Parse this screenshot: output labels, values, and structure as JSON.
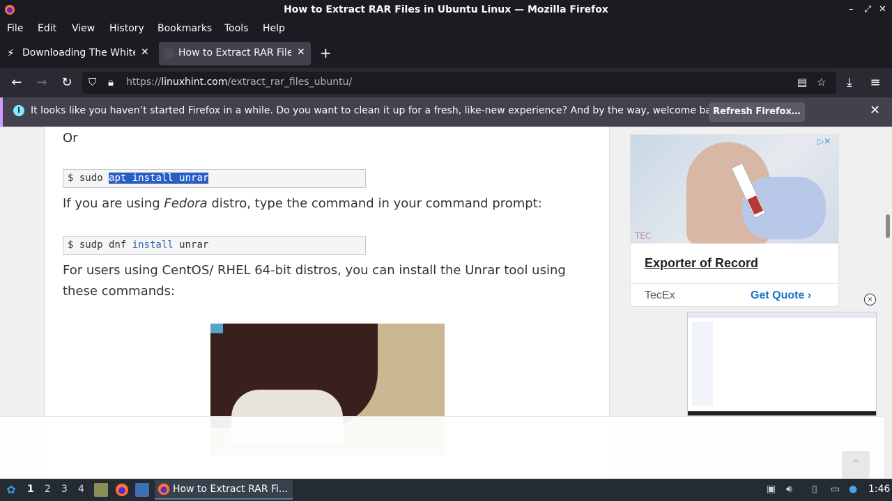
{
  "window": {
    "title": "How to Extract RAR Files in Ubuntu Linux — Mozilla Firefox",
    "controls": [
      "minimize",
      "maximize",
      "close"
    ]
  },
  "menu": {
    "items": [
      "File",
      "Edit",
      "View",
      "History",
      "Bookmarks",
      "Tools",
      "Help"
    ]
  },
  "tabs": [
    {
      "label": "Downloading The White House",
      "active": false,
      "icon": "lightning-icon"
    },
    {
      "label": "How to Extract RAR Files",
      "active": true,
      "icon": "linuxhint-favicon-icon"
    }
  ],
  "navbar": {
    "url_prefix": "https://",
    "url_domain": "linuxhint.com",
    "url_path": "/extract_rar_files_ubuntu/"
  },
  "notification": {
    "message": "It looks like you haven’t started Firefox in a while. Do you want to clean it up for a fresh, like-new experience? And by the way, welcome back!",
    "button_label": "Refresh Firefox…"
  },
  "article": {
    "or_text": "Or",
    "cmd1_prompt": "$ sudo ",
    "cmd1_selected": "apt install unrar",
    "fedora_pre": "If you are using ",
    "fedora_em": "Fedora",
    "fedora_post": " distro, type the command in your command prompt:",
    "cmd2_prompt": "$ sudp dnf ",
    "cmd2_kw": "install",
    "cmd2_rest": " unrar",
    "centos_line1": "For users using CentOS/ RHEL 64-bit distros, you can install the Unrar tool using",
    "centos_line2": "these commands:"
  },
  "ad": {
    "watermark": "TEC",
    "title": "Exporter of Record",
    "brand": "TecEx",
    "cta": "Get Quote",
    "close_symbol": "×"
  },
  "taskbar": {
    "workspaces": [
      "1",
      "2",
      "3",
      "4"
    ],
    "current_workspace": "1",
    "app_label": "How to Extract RAR Fi...",
    "clock": "1:46"
  },
  "colors": {
    "firefox_dark": "#1c1b22",
    "toolbar": "#2b2a33",
    "notification_accent": "#cb9bff",
    "selection": "#2a5ec4",
    "ad_cta": "#1a73c8"
  }
}
